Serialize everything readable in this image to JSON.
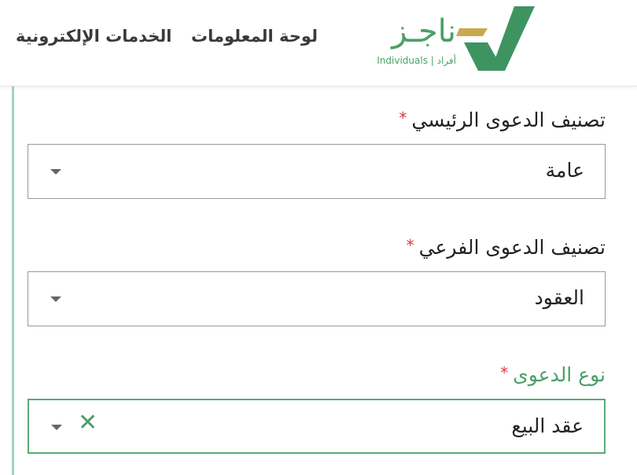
{
  "header": {
    "nav": {
      "eservices_label": "الخدمات الإلكترونية",
      "dashboard_label": "لوحة المعلومات"
    },
    "logo": {
      "name": "ناجـز",
      "subtitle": "أفراد | Individuals"
    }
  },
  "form": {
    "fields": [
      {
        "label": "تصنيف الدعوى الرئيسي",
        "required_mark": "*",
        "value": "عامة"
      },
      {
        "label": "تصنيف الدعوى الفرعي",
        "required_mark": "*",
        "value": "العقود"
      },
      {
        "label": "نوع الدعوى",
        "required_mark": "*",
        "value": "عقد البيع",
        "clear_glyph": "✕"
      }
    ]
  },
  "colors": {
    "brand_green": "#4b9f68",
    "brand_gold": "#c9a94f",
    "required_red": "#e0383e",
    "side_accent": "#9fd3c7"
  },
  "icons": [
    "dropdown-caret-icon",
    "clear-icon"
  ]
}
